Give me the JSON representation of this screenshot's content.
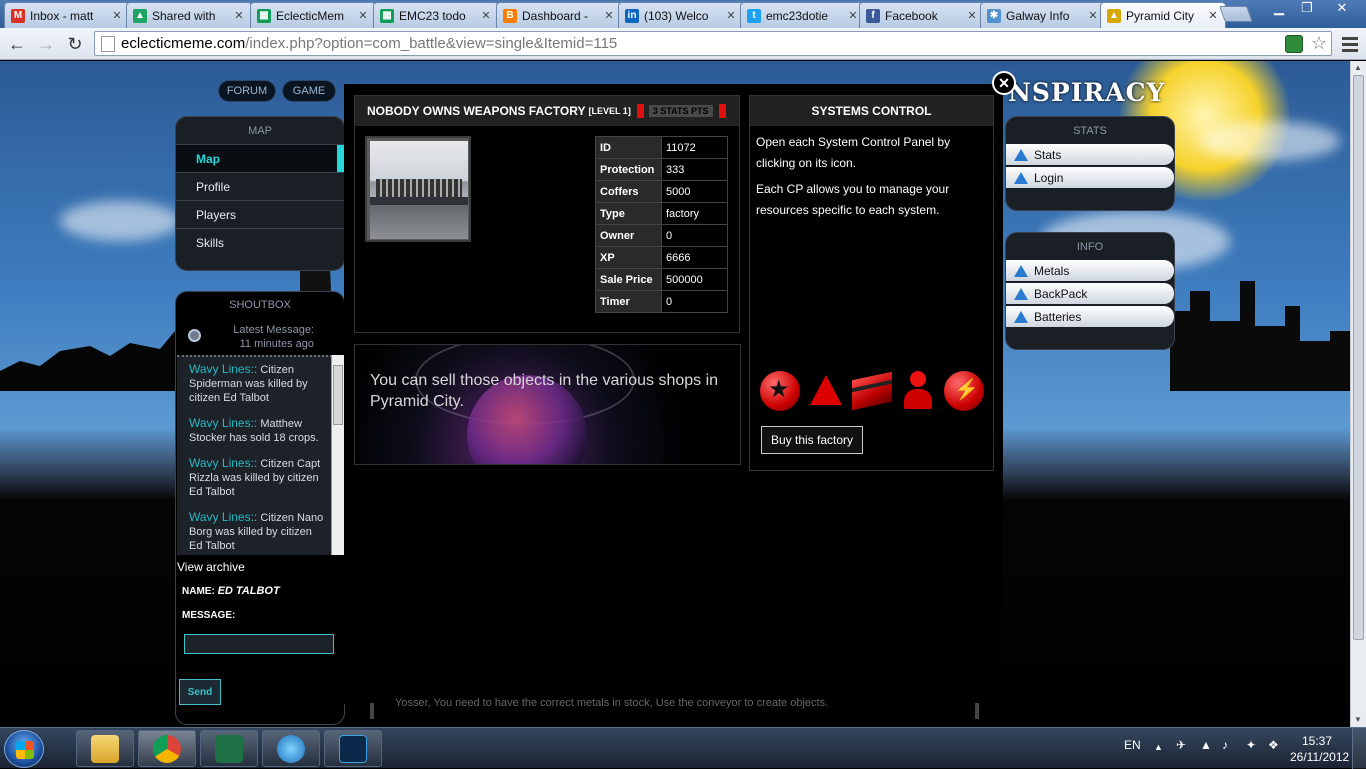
{
  "browser": {
    "tabs": [
      {
        "label": "Inbox - matt",
        "favicon": "gmail-icon",
        "color": "#d93025",
        "glyph": "M"
      },
      {
        "label": "Shared with",
        "favicon": "drive-icon",
        "color": "#1fa463",
        "glyph": "▲"
      },
      {
        "label": "EclecticMem",
        "favicon": "sheets-icon",
        "color": "#0f9d58",
        "glyph": "▦"
      },
      {
        "label": "EMC23 todo",
        "favicon": "sheets-icon",
        "color": "#0f9d58",
        "glyph": "▦"
      },
      {
        "label": "Dashboard -",
        "favicon": "blogger-icon",
        "color": "#f57d00",
        "glyph": "B"
      },
      {
        "label": "(103) Welco",
        "favicon": "linkedin-icon",
        "color": "#0a66c2",
        "glyph": "in"
      },
      {
        "label": "emc23dotie",
        "favicon": "twitter-icon",
        "color": "#1da1f2",
        "glyph": "t"
      },
      {
        "label": "Facebook",
        "favicon": "facebook-icon",
        "color": "#3b5998",
        "glyph": "f"
      },
      {
        "label": "Galway Info",
        "favicon": "joomla-icon",
        "color": "#5091cd",
        "glyph": "✱"
      },
      {
        "label": "Pyramid City",
        "favicon": "warning-icon",
        "color": "#d4a800",
        "glyph": "▲"
      }
    ],
    "url_host": "eclecticmeme.com",
    "url_path": "/index.php?option=com_battle&view=single&Itemid=115"
  },
  "site": {
    "top_nav": [
      "FORUM",
      "GAME"
    ],
    "logo_text": "NSPIRACY",
    "menu": {
      "header": "MAP",
      "items": [
        "Map",
        "Profile",
        "Players",
        "Skills"
      ]
    },
    "shoutbox": {
      "header": "SHOUTBOX",
      "latest": "Latest Message:",
      "latest_time": "11 minutes ago",
      "messages": [
        {
          "who": "Wavy Lines::",
          "text": "Citizen Spiderman was killed by citizen Ed Talbot"
        },
        {
          "who": "Wavy Lines::",
          "text": "Matthew Stocker has sold 18 crops."
        },
        {
          "who": "Wavy Lines::",
          "text": "Citizen Capt Rizzla was killed by citizen Ed Talbot"
        },
        {
          "who": "Wavy Lines::",
          "text": "Citizen Nano Borg was killed by citizen Ed Talbot"
        }
      ],
      "archive_label": "View archive",
      "name_label": "NAME:",
      "name_value": "ED TALBOT",
      "message_label": "MESSAGE:",
      "send_label": "Send"
    },
    "stats_box": {
      "header": "STATS",
      "items": [
        "Stats",
        "Login"
      ]
    },
    "info_box": {
      "header": "INFO",
      "items": [
        "Metals",
        "BackPack",
        "Batteries"
      ]
    }
  },
  "modal": {
    "factory": {
      "title": "NOBODY OWNS WEAPONS FACTORY",
      "level": "[LEVEL 1]",
      "stats_pts": "3 STATS PTS",
      "rows": [
        {
          "k": "ID",
          "v": "11072"
        },
        {
          "k": "Protection",
          "v": "333"
        },
        {
          "k": "Coffers",
          "v": "5000"
        },
        {
          "k": "Type",
          "v": "factory"
        },
        {
          "k": "Owner",
          "v": "0"
        },
        {
          "k": "XP",
          "v": "6666"
        },
        {
          "k": "Sale Price",
          "v": "500000"
        },
        {
          "k": "Timer",
          "v": "0"
        }
      ]
    },
    "info_text": "You can sell those objects in the various shops in Pyramid City.",
    "systems": {
      "title": "SYSTEMS CONTROL",
      "p1": "Open each System Control Panel by clicking on its icon.",
      "p2": "Each CP allows you to manage your resources specific to each system.",
      "buy_label": "Buy this factory"
    },
    "underlay_text": "Yosser, You need to have the correct metals in stock, Use the conveyor to create objects."
  },
  "taskbar": {
    "lang": "EN",
    "time": "15:37",
    "date": "26/11/2012"
  }
}
